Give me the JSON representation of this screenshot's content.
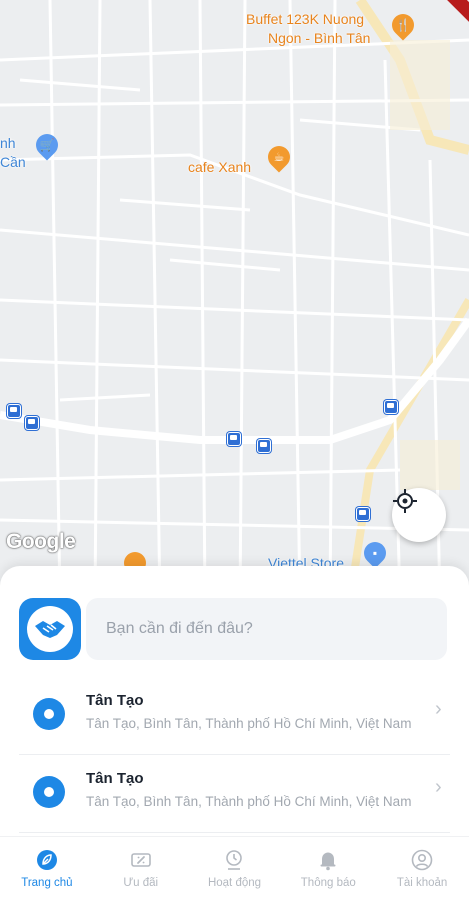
{
  "map": {
    "pois": [
      {
        "label": "Buffet 123K Nuong",
        "type": "restaurant"
      },
      {
        "label": "Ngon - Bình Tân",
        "type": "restaurant"
      },
      {
        "label": "cafe Xanh",
        "type": "cafe"
      },
      {
        "label": "nh",
        "type": "shop"
      },
      {
        "label": "Cần",
        "type": "shop"
      },
      {
        "label": "Viettel Store",
        "type": "shop"
      }
    ],
    "attribution": "Google",
    "colors": {
      "map_bg": "#eceef0",
      "road": "#ffffff",
      "poi_orange": "#e8841e",
      "bus_stop": "#2f6fd4"
    }
  },
  "sheet": {
    "search_placeholder": "Bạn cần đi đến đâu?",
    "recent_places": [
      {
        "title": "Tân Tạo",
        "address": "Tân Tạo, Bình Tân, Thành phố Hồ Chí Minh, Việt Nam"
      },
      {
        "title": "Tân Tạo",
        "address": "Tân Tạo, Bình Tân, Thành phố Hồ Chí Minh, Việt Nam"
      }
    ]
  },
  "nav": {
    "items": [
      {
        "label": "Trang chủ",
        "icon": "home-leaf-icon",
        "active": true
      },
      {
        "label": "Ưu đãi",
        "icon": "coupon-icon",
        "active": false
      },
      {
        "label": "Hoạt động",
        "icon": "activity-icon",
        "active": false
      },
      {
        "label": "Thông báo",
        "icon": "bell-icon",
        "active": false
      },
      {
        "label": "Tài khoản",
        "icon": "account-icon",
        "active": false
      }
    ]
  },
  "colors": {
    "accent": "#1e88e5",
    "inactive": "#b4b9c0"
  }
}
